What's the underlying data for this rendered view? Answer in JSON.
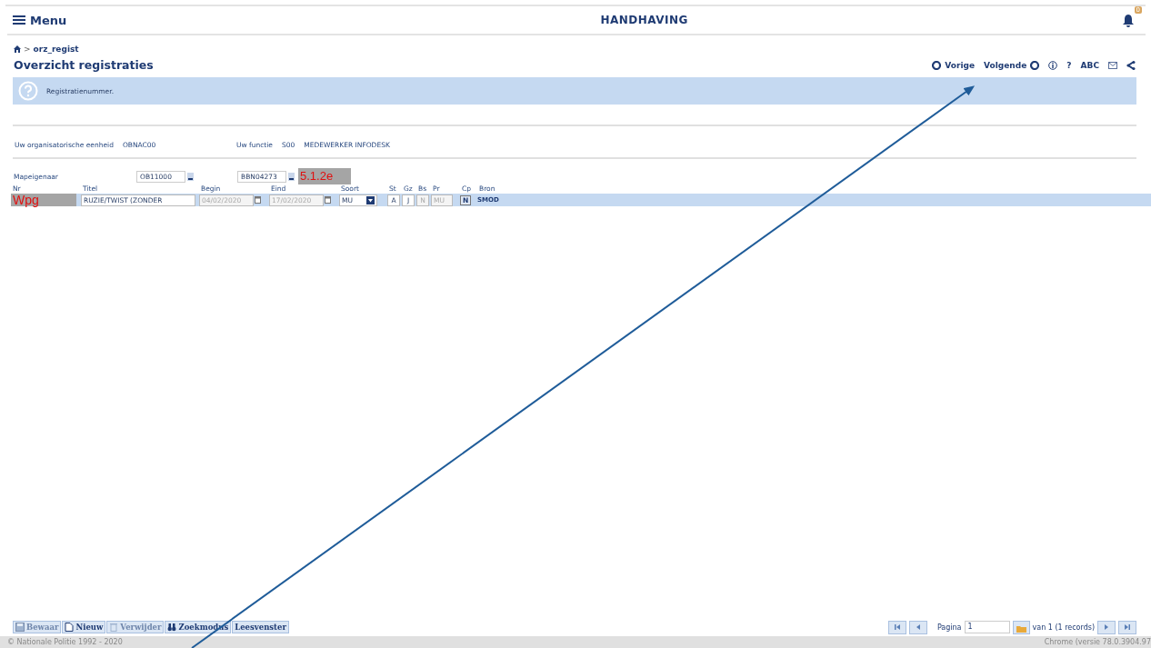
{
  "header": {
    "menu_label": "Menu",
    "title": "HANDHAVING",
    "notification_count": "0"
  },
  "breadcrumb": {
    "separator": ">",
    "current": "orz_regist"
  },
  "page_title": "Overzicht registraties",
  "toolbar": [
    {
      "kind": "prev",
      "label": "Vorige"
    },
    {
      "kind": "next",
      "label": "Volgende"
    },
    {
      "kind": "info"
    },
    {
      "kind": "text",
      "label": "?"
    },
    {
      "kind": "text",
      "label": "ABC"
    },
    {
      "kind": "mail"
    },
    {
      "kind": "share"
    }
  ],
  "info_message": "Registratienummer.",
  "context": [
    {
      "label": "Uw organisatorische eenheid",
      "values": [
        "OBNAC00"
      ]
    },
    {
      "label": "Uw functie",
      "values": [
        "S00",
        "MEDEWERKER INFODESK"
      ]
    }
  ],
  "owner": {
    "label": "Mapeigenaar",
    "fields": [
      "OB11000",
      "BBN04273"
    ],
    "redaction": "5.1.2e"
  },
  "table": {
    "columns": [
      "Nr",
      "Titel",
      "Begin",
      "Eind",
      "Soort",
      "St",
      "Gz",
      "Bs",
      "Pr",
      "Cp",
      "Bron"
    ],
    "rows": [
      {
        "selected": true,
        "cells": [
          {
            "kind": "redaction",
            "text": "Wpg"
          },
          {
            "kind": "input",
            "text": "RUZIE/TWIST (ZONDER",
            "disabled": false
          },
          {
            "kind": "date",
            "text": "04/02/2020",
            "disabled": true
          },
          {
            "kind": "date",
            "text": "17/02/2020",
            "disabled": true
          },
          {
            "kind": "select",
            "text": "MU",
            "disabled": false
          },
          {
            "kind": "small",
            "text": "A",
            "disabled": false
          },
          {
            "kind": "small",
            "text": "J",
            "disabled": false
          },
          {
            "kind": "small",
            "text": "N",
            "disabled": true
          },
          {
            "kind": "mid",
            "text": "MU",
            "disabled": true
          },
          {
            "kind": "toggle",
            "text": "N",
            "disabled": false
          },
          {
            "kind": "label",
            "text": "SMOD"
          }
        ]
      }
    ]
  },
  "actions": [
    {
      "kind": "save",
      "label": "Bewaar",
      "disabled": true
    },
    {
      "kind": "new",
      "label": "Nieuw",
      "disabled": false
    },
    {
      "kind": "delete",
      "label": "Verwijder",
      "disabled": true
    },
    {
      "kind": "search",
      "label": "Zoekmodus",
      "disabled": false
    },
    {
      "kind": "plain",
      "label": "Leesvenster",
      "disabled": false
    }
  ],
  "pager": {
    "label": "Pagina",
    "value": "1",
    "summary": "van 1 (1 records)"
  },
  "footer": {
    "copyright": "© Nationale Politie 1992 - 2020",
    "browser": "Chrome (versie 78.0.3904.97"
  }
}
